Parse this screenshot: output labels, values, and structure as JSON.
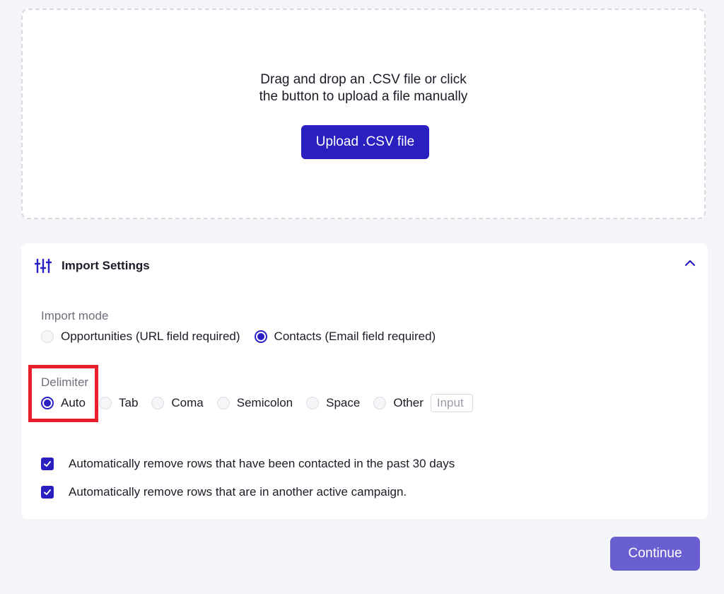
{
  "dropzone": {
    "line1": "Drag and drop an .CSV file or click",
    "line2": "the button to upload a file manually",
    "upload_label": "Upload .CSV file"
  },
  "settings": {
    "title": "Import Settings",
    "icon": "sliders-icon",
    "collapse_icon": "chevron-up-icon",
    "import_mode": {
      "label": "Import mode",
      "options": [
        {
          "label": "Opportunities (URL field required)",
          "selected": false
        },
        {
          "label": "Contacts (Email field required)",
          "selected": true
        }
      ]
    },
    "delimiter": {
      "label": "Delimiter",
      "options": [
        {
          "label": "Auto",
          "selected": true
        },
        {
          "label": "Tab",
          "selected": false
        },
        {
          "label": "Coma",
          "selected": false
        },
        {
          "label": "Semicolon",
          "selected": false
        },
        {
          "label": "Space",
          "selected": false
        },
        {
          "label": "Other",
          "selected": false
        }
      ],
      "other_placeholder": "Input"
    },
    "checkboxes": [
      {
        "label": "Automatically remove rows that have been contacted in the past 30 days",
        "checked": true
      },
      {
        "label": "Automatically remove rows that are in another active campaign.",
        "checked": true
      }
    ]
  },
  "continue_label": "Continue",
  "colors": {
    "primary": "#2a1fbf",
    "continue": "#6a5fd0",
    "highlight": "#e8202e",
    "background": "#f4f5f9"
  }
}
